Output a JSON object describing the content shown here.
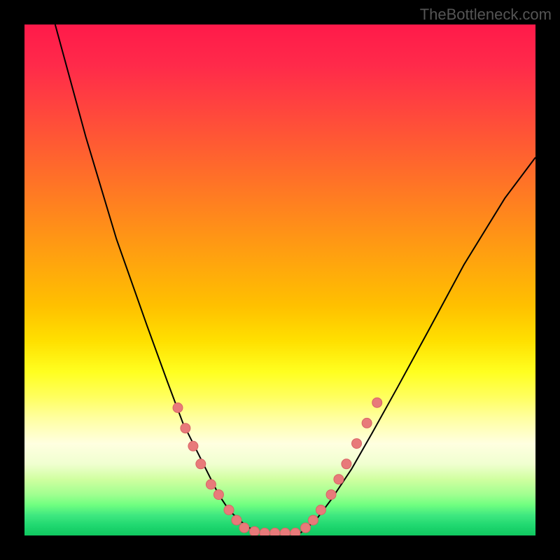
{
  "watermark": "TheBottleneck.com",
  "chart_data": {
    "type": "line",
    "title": "",
    "xlabel": "",
    "ylabel": "",
    "xlim": [
      0,
      100
    ],
    "ylim": [
      0,
      100
    ],
    "background_gradient": {
      "top_color": "#ff1a4a",
      "bottom_color": "#10c860",
      "description": "red-yellow-green vertical gradient representing bottleneck severity"
    },
    "series": [
      {
        "name": "left-curve",
        "x": [
          6,
          12,
          18,
          24,
          28,
          31,
          33.5,
          36,
          38,
          40,
          42,
          44,
          46
        ],
        "y": [
          100,
          78,
          58,
          41,
          30,
          22,
          17,
          12,
          8,
          5,
          3,
          1.5,
          0.5
        ]
      },
      {
        "name": "right-curve",
        "x": [
          54,
          57,
          60,
          64,
          68,
          73,
          79,
          86,
          94,
          100
        ],
        "y": [
          0.5,
          3,
          7,
          13,
          20,
          29,
          40,
          53,
          66,
          74
        ]
      }
    ],
    "markers": {
      "name": "data-points",
      "description": "salmon colored circular markers along lower portions of both curves and valley floor",
      "points": [
        {
          "x": 30,
          "y": 25
        },
        {
          "x": 31.5,
          "y": 21
        },
        {
          "x": 33,
          "y": 17.5
        },
        {
          "x": 34.5,
          "y": 14
        },
        {
          "x": 36.5,
          "y": 10
        },
        {
          "x": 38,
          "y": 8
        },
        {
          "x": 40,
          "y": 5
        },
        {
          "x": 41.5,
          "y": 3
        },
        {
          "x": 43,
          "y": 1.5
        },
        {
          "x": 45,
          "y": 0.8
        },
        {
          "x": 47,
          "y": 0.5
        },
        {
          "x": 49,
          "y": 0.5
        },
        {
          "x": 51,
          "y": 0.5
        },
        {
          "x": 53,
          "y": 0.5
        },
        {
          "x": 55,
          "y": 1.5
        },
        {
          "x": 56.5,
          "y": 3
        },
        {
          "x": 58,
          "y": 5
        },
        {
          "x": 60,
          "y": 8
        },
        {
          "x": 61.5,
          "y": 11
        },
        {
          "x": 63,
          "y": 14
        },
        {
          "x": 65,
          "y": 18
        },
        {
          "x": 67,
          "y": 22
        },
        {
          "x": 69,
          "y": 26
        }
      ]
    }
  }
}
